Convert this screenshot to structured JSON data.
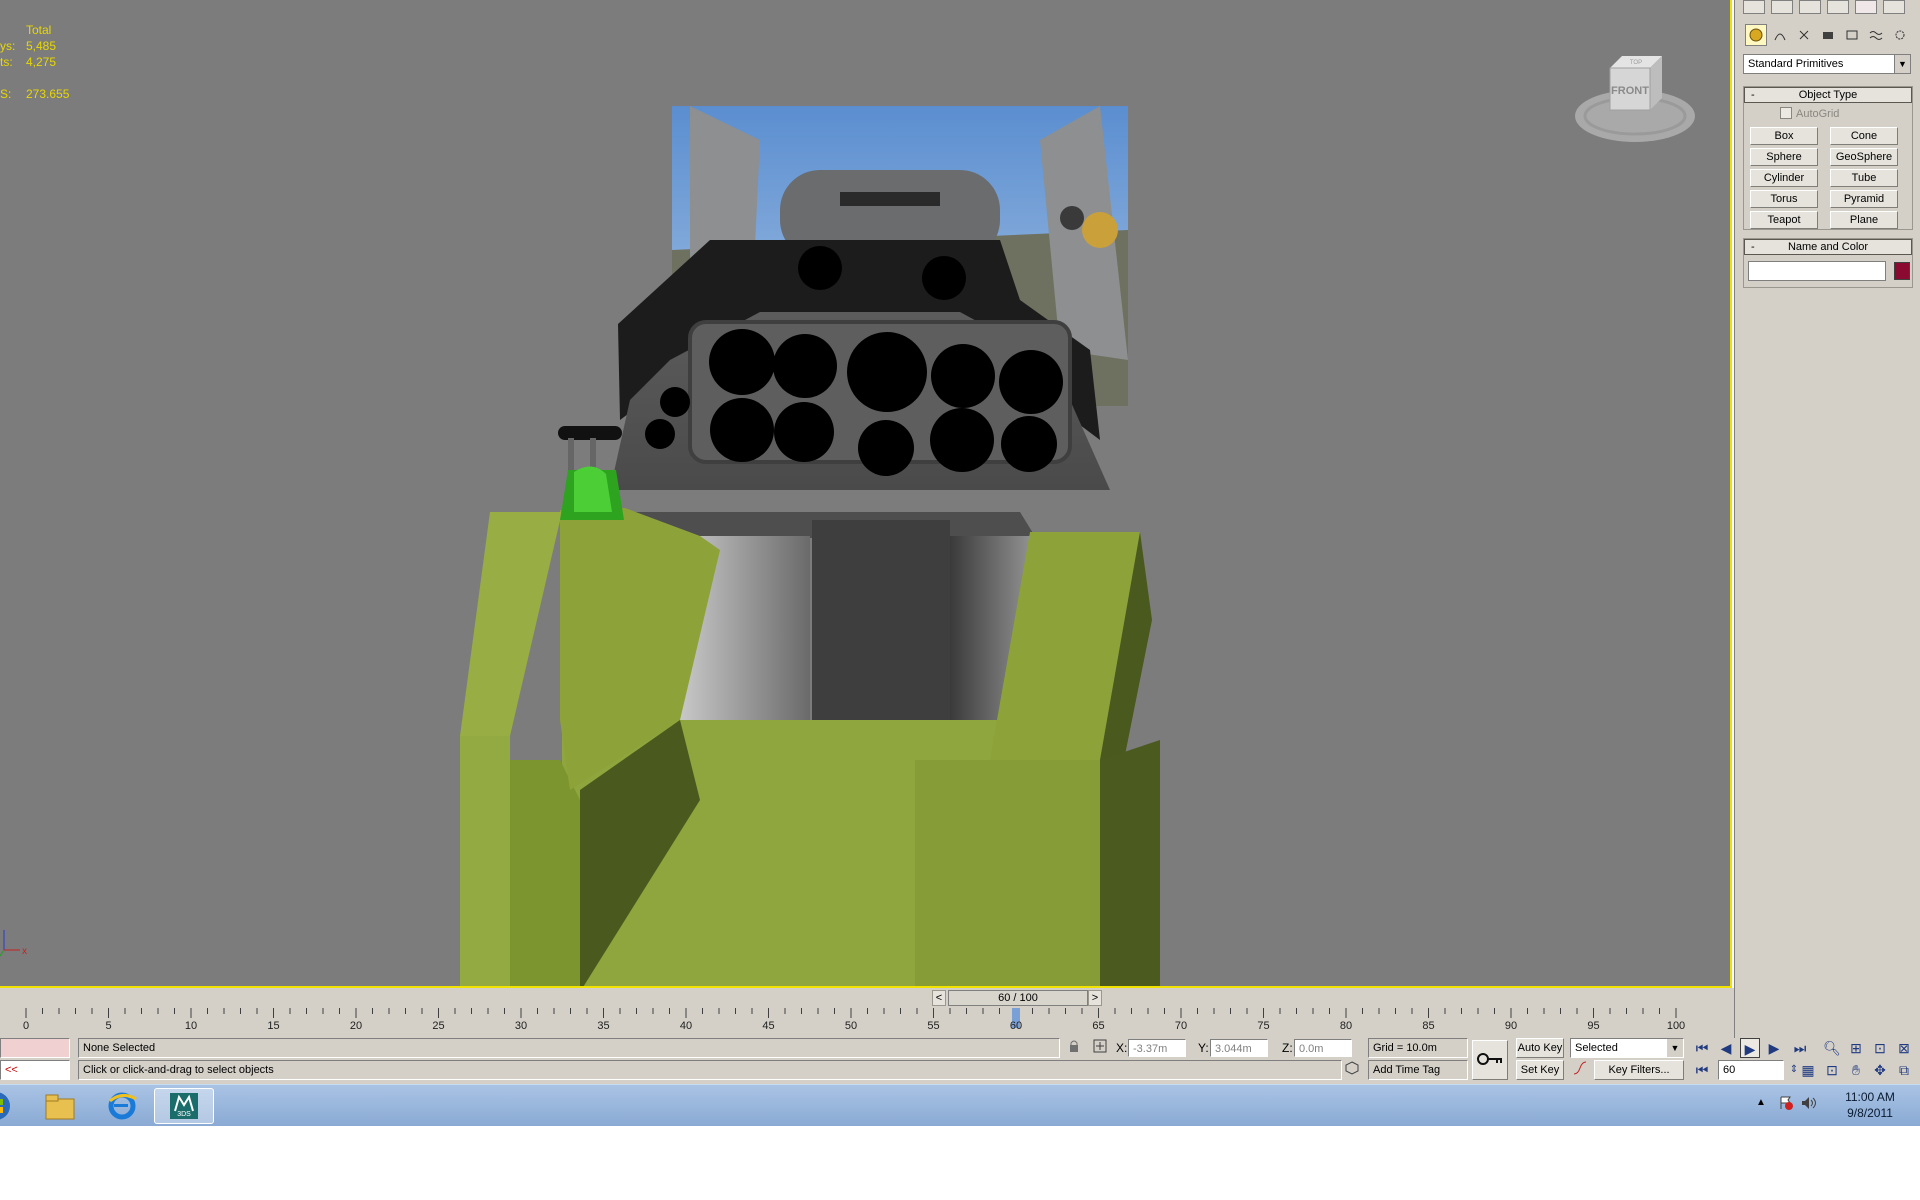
{
  "viewport": {
    "stats": [
      {
        "key": "",
        "value": "Total"
      },
      {
        "key": "ys:",
        "value": "5,485"
      },
      {
        "key": "ts:",
        "value": "4,275"
      },
      {
        "key": "S:",
        "value": "273.655"
      }
    ],
    "viewcube_label": "FRONT",
    "viewcube_top_label": "TOP",
    "axis_x_label": "x"
  },
  "command_panel": {
    "primitive_type": "Standard Primitives",
    "object_type_title": "Object Type",
    "autogrid_label": "AutoGrid",
    "primitives": [
      "Box",
      "Cone",
      "Sphere",
      "GeoSphere",
      "Cylinder",
      "Tube",
      "Torus",
      "Pyramid",
      "Teapot",
      "Plane"
    ],
    "name_color_title": "Name and Color",
    "object_color": "#8b0a32"
  },
  "timeline": {
    "frame_display": "60 / 100",
    "current_frame": 60,
    "total_frames": 100,
    "tick_labels": [
      "0",
      "5",
      "10",
      "15",
      "20",
      "25",
      "30",
      "35",
      "40",
      "45",
      "50",
      "55",
      "60",
      "65",
      "70",
      "75",
      "80",
      "85",
      "90",
      "95",
      "100"
    ]
  },
  "status": {
    "selection": "None Selected",
    "prompt": "Click or click-and-drag to select objects",
    "x_label": "X:",
    "x_value": "-3.37m",
    "y_label": "Y:",
    "y_value": "3.044m",
    "z_label": "Z:",
    "z_value": "0.0m",
    "grid": "Grid = 10.0m",
    "add_time_tag": "Add Time Tag",
    "auto_key": "Auto Key",
    "set_key": "Set Key",
    "key_mode": "Selected",
    "key_filters": "Key Filters...",
    "frame_field": "60",
    "listener_text": "<<"
  },
  "taskbar": {
    "time": "11:00 AM",
    "date": "9/8/2011",
    "max_app_label": "3DS"
  }
}
